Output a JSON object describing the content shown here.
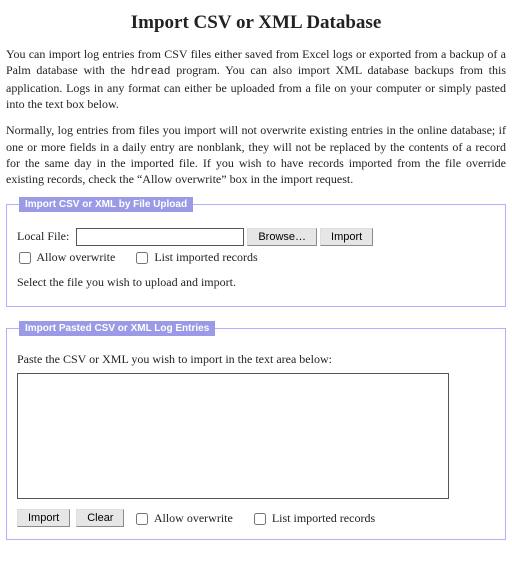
{
  "title": "Import CSV or XML Database",
  "intro1_a": "You can import log entries from CSV files either saved from Excel logs or exported from a backup of a Palm database with the ",
  "intro1_code": "hdread",
  "intro1_b": " program. You can also import XML database backups from this application. Logs in any format can either be uploaded from a file on your computer or simply pasted into the text box below.",
  "intro2": "Normally, log entries from files you import will not overwrite existing entries in the online database; if one or more fields in a daily entry are nonblank, they will not be replaced by the contents of a record for the same day in the imported file. If you wish to have records imported from the file override existing records, check the “Allow overwrite” box in the import request.",
  "upload": {
    "legend": "Import CSV or XML by File Upload",
    "local_file_label": "Local File:",
    "file_value": "",
    "browse_label": "Browse…",
    "import_label": "Import",
    "allow_overwrite_label": "Allow overwrite",
    "list_imported_label": "List imported records",
    "hint": "Select the file you wish to upload and import."
  },
  "paste": {
    "legend": "Import Pasted CSV or XML Log Entries",
    "instruction": "Paste the CSV or XML you wish to import in the text area below:",
    "textarea_value": "",
    "import_label": "Import",
    "clear_label": "Clear",
    "allow_overwrite_label": "Allow overwrite",
    "list_imported_label": "List imported records"
  }
}
